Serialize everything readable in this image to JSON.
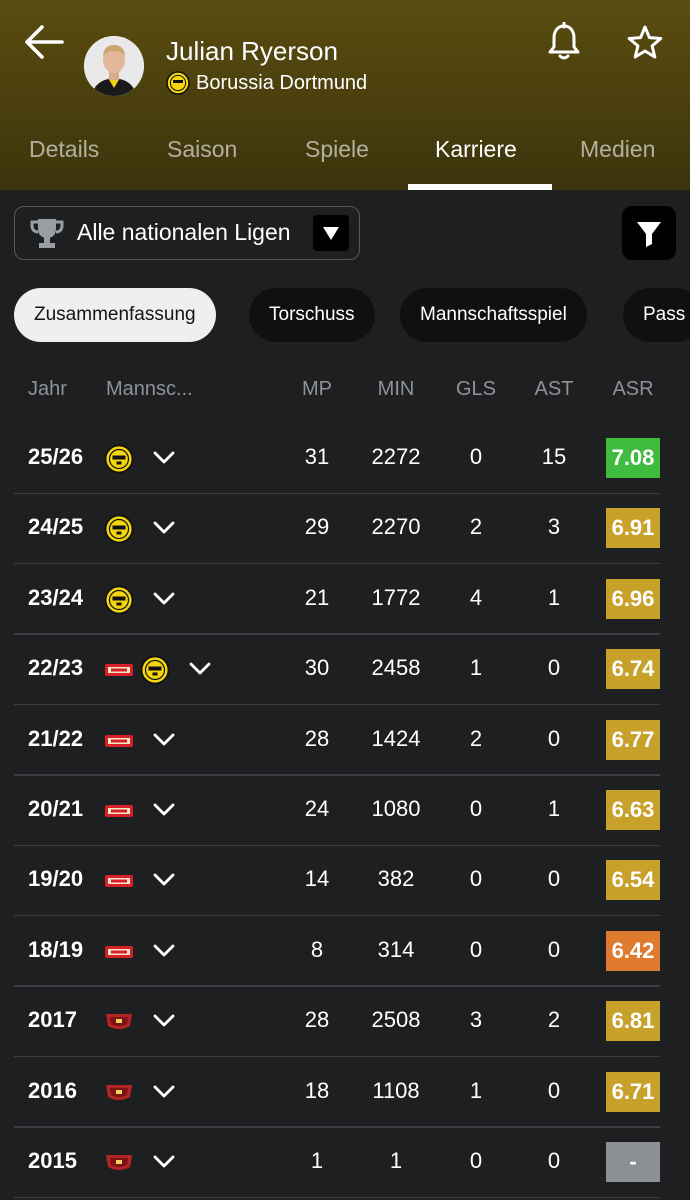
{
  "player": {
    "name": "Julian Ryerson",
    "club": "Borussia Dortmund",
    "club_crest_text": "BVB 09"
  },
  "tabs": [
    {
      "label": "Details",
      "active": false
    },
    {
      "label": "Saison",
      "active": false
    },
    {
      "label": "Spiele",
      "active": false
    },
    {
      "label": "Karriere",
      "active": true
    },
    {
      "label": "Medien",
      "active": false
    }
  ],
  "filter": {
    "league": "Alle nationalen Ligen"
  },
  "chips": [
    {
      "label": "Zusammenfassung",
      "active": true
    },
    {
      "label": "Torschuss",
      "active": false
    },
    {
      "label": "Mannschaftsspiel",
      "active": false
    },
    {
      "label": "Pass",
      "active": false
    }
  ],
  "table": {
    "headers": {
      "year": "Jahr",
      "team": "Mannsc...",
      "mp": "MP",
      "min": "MIN",
      "gls": "GLS",
      "ast": "AST",
      "asr": "ASR"
    },
    "rows": [
      {
        "year": "25/26",
        "teams": [
          "bvb"
        ],
        "mp": "31",
        "min": "2272",
        "gls": "0",
        "ast": "15",
        "asr": "7.08",
        "asr_color": "#3fbb3f"
      },
      {
        "year": "24/25",
        "teams": [
          "bvb"
        ],
        "mp": "29",
        "min": "2270",
        "gls": "2",
        "ast": "3",
        "asr": "6.91",
        "asr_color": "#c8a12a"
      },
      {
        "year": "23/24",
        "teams": [
          "bvb"
        ],
        "mp": "21",
        "min": "1772",
        "gls": "4",
        "ast": "1",
        "asr": "6.96",
        "asr_color": "#c8a12a"
      },
      {
        "year": "22/23",
        "teams": [
          "union",
          "bvb"
        ],
        "mp": "30",
        "min": "2458",
        "gls": "1",
        "ast": "0",
        "asr": "6.74",
        "asr_color": "#c8a12a"
      },
      {
        "year": "21/22",
        "teams": [
          "union"
        ],
        "mp": "28",
        "min": "1424",
        "gls": "2",
        "ast": "0",
        "asr": "6.77",
        "asr_color": "#c8a12a"
      },
      {
        "year": "20/21",
        "teams": [
          "union"
        ],
        "mp": "24",
        "min": "1080",
        "gls": "0",
        "ast": "1",
        "asr": "6.63",
        "asr_color": "#c8a12a"
      },
      {
        "year": "19/20",
        "teams": [
          "union"
        ],
        "mp": "14",
        "min": "382",
        "gls": "0",
        "ast": "0",
        "asr": "6.54",
        "asr_color": "#c8a12a"
      },
      {
        "year": "18/19",
        "teams": [
          "union"
        ],
        "mp": "8",
        "min": "314",
        "gls": "0",
        "ast": "0",
        "asr": "6.42",
        "asr_color": "#e07a2e"
      },
      {
        "year": "2017",
        "teams": [
          "viking"
        ],
        "mp": "28",
        "min": "2508",
        "gls": "3",
        "ast": "2",
        "asr": "6.81",
        "asr_color": "#c8a12a"
      },
      {
        "year": "2016",
        "teams": [
          "viking"
        ],
        "mp": "18",
        "min": "1108",
        "gls": "1",
        "ast": "0",
        "asr": "6.71",
        "asr_color": "#c8a12a"
      },
      {
        "year": "2015",
        "teams": [
          "viking"
        ],
        "mp": "1",
        "min": "1",
        "gls": "0",
        "ast": "0",
        "asr": "-",
        "asr_color": "#8c8f93"
      }
    ]
  },
  "icons": {
    "back": "back-arrow-icon",
    "bell": "bell-icon",
    "star": "star-icon",
    "trophy": "trophy-icon",
    "dropdown": "triangle-down-icon",
    "filter": "filter-icon",
    "chevron": "chevron-down-icon"
  },
  "colors": {
    "header_bg": "#4f4410",
    "page_bg": "#1d1f21",
    "bvb_yellow": "#f5d60e",
    "union_red": "#d8202a"
  }
}
